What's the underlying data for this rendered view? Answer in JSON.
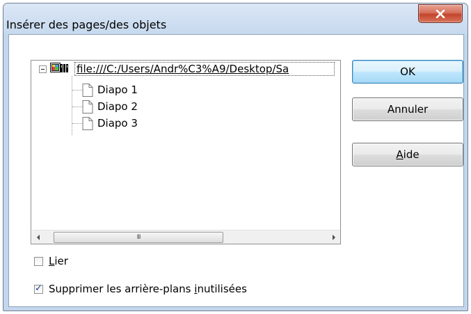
{
  "window": {
    "title": "Insérer des pages/des objets",
    "close_icon": "close-icon"
  },
  "tree": {
    "root_label": "file:///C:/Users/Andr%C3%A9/Desktop/Sa",
    "root_icon": "presentation-icon",
    "items": [
      {
        "label": "Diapo 1",
        "icon": "page-icon"
      },
      {
        "label": "Diapo 2",
        "icon": "page-icon"
      },
      {
        "label": "Diapo 3",
        "icon": "page-icon"
      }
    ],
    "scrollbar_grip": "III"
  },
  "buttons": {
    "ok": "OK",
    "cancel": "Annuler",
    "help_mnemonic": "A",
    "help_rest": "ide"
  },
  "options": {
    "link": {
      "mnemonic": "L",
      "rest": "ier",
      "checked": false
    },
    "delete_unused_backgrounds": {
      "before": "Supprimer les arrière-plans ",
      "mnemonic": "i",
      "after": "nutilisées",
      "checked": true
    }
  },
  "colors": {
    "frame": "#c3d6ec",
    "close_red": "#c3452d",
    "default_button_border": "#3c7fb1"
  }
}
